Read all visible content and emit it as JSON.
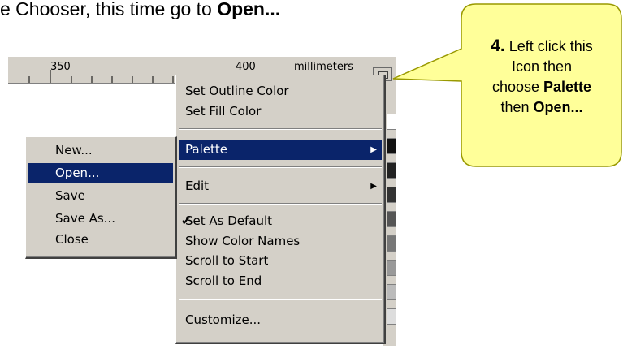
{
  "instruction": {
    "text_before": "e Chooser, this time go to ",
    "text_bold": "Open..."
  },
  "ruler": {
    "label_350": "350",
    "label_400": "400",
    "units": "millimeters"
  },
  "context_menu": {
    "items": [
      {
        "label": "Set Outline Color"
      },
      {
        "label": "Set Fill Color"
      },
      {
        "label": "Palette"
      },
      {
        "label": "Edit"
      },
      {
        "label": "Set As Default"
      },
      {
        "label": "Show Color Names"
      },
      {
        "label": "Scroll to Start"
      },
      {
        "label": "Scroll to End"
      },
      {
        "label": "Customize..."
      }
    ],
    "check_glyph": "✔",
    "submenu_arrow": "▶"
  },
  "palette_submenu": {
    "items": [
      {
        "label": "New..."
      },
      {
        "label": "Open..."
      },
      {
        "label": "Save"
      },
      {
        "label": "Save As..."
      },
      {
        "label": "Close"
      }
    ]
  },
  "callout": {
    "number": "4.",
    "line1": " Left click this",
    "line2": "Icon then",
    "line3_pre": "choose ",
    "line3_bold": "Palette",
    "line4_pre": "then ",
    "line4_bold": "Open...",
    "fill_color": "#ffff99",
    "border_color": "#999900"
  },
  "colors": {
    "menu_bg": "#d4d0c8",
    "highlight": "#0a246a"
  }
}
